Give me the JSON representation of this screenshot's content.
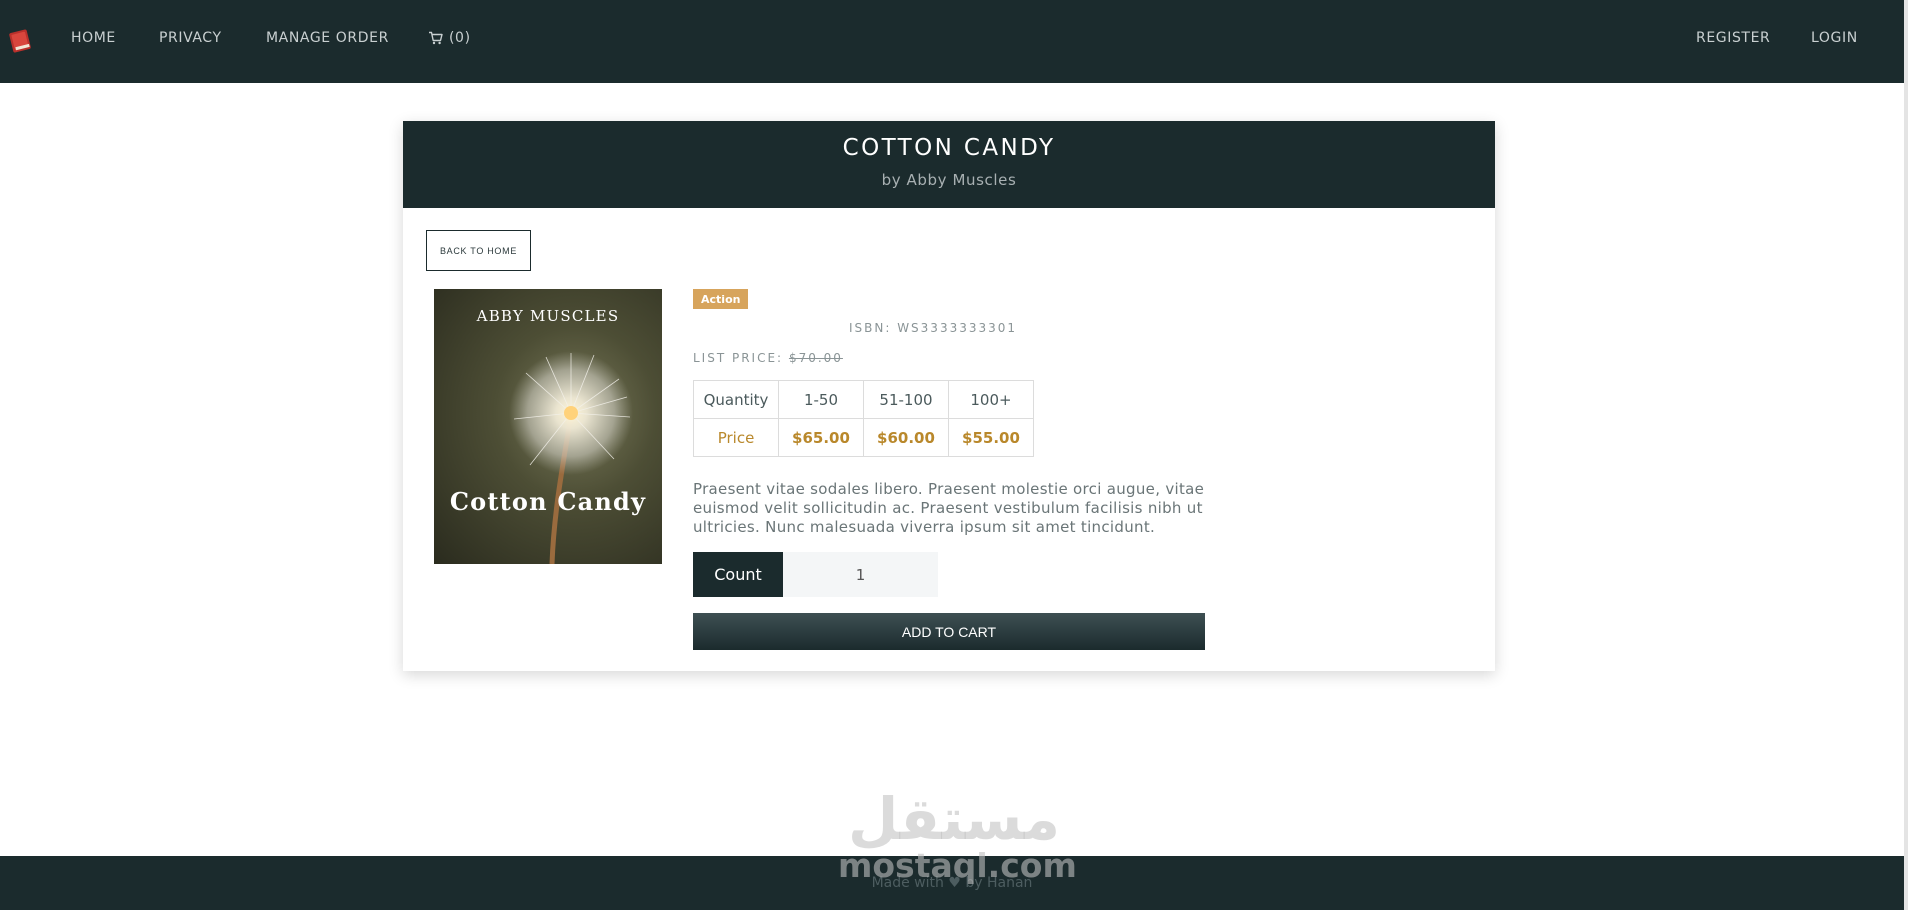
{
  "nav": {
    "home": "HOME",
    "privacy": "PRIVACY",
    "manage_order": "MANAGE ORDER",
    "cart_count": "(0)",
    "register": "REGISTER",
    "login": "LOGIN",
    "logo_icon": "book-icon",
    "cart_icon": "cart-icon"
  },
  "product": {
    "title": "COTTON CANDY",
    "author": "by Abby Muscles",
    "back_label": "BACK TO HOME",
    "cover": {
      "author": "ABBY MUSCLES",
      "title": "Cotton Candy"
    },
    "category": "Action",
    "isbn": "ISBN: WS3333333301",
    "list_price_label": "LIST PRICE:",
    "list_price": "$70.00",
    "price_table": {
      "header": [
        "Quantity",
        "1-50",
        "51-100",
        "100+"
      ],
      "prices": [
        "Price",
        "$65.00",
        "$60.00",
        "$55.00"
      ]
    },
    "description": "Praesent vitae sodales libero. Praesent molestie orci augue, vitae euismod velit sollicitudin ac. Praesent vestibulum facilisis nibh ut ultricies. Nunc malesuada viverra ipsum sit amet tincidunt.",
    "count_label": "Count",
    "count_value": "1",
    "add_to_cart": "ADD TO CART"
  },
  "footer": {
    "text": "Made with ♥ by Hanan"
  },
  "watermark": {
    "arabic": "مستقل",
    "latin": "mostaql.com"
  },
  "colors": {
    "navbar": "#1b2b2d",
    "badge": "#d7a45c",
    "price": "#b9882b"
  }
}
